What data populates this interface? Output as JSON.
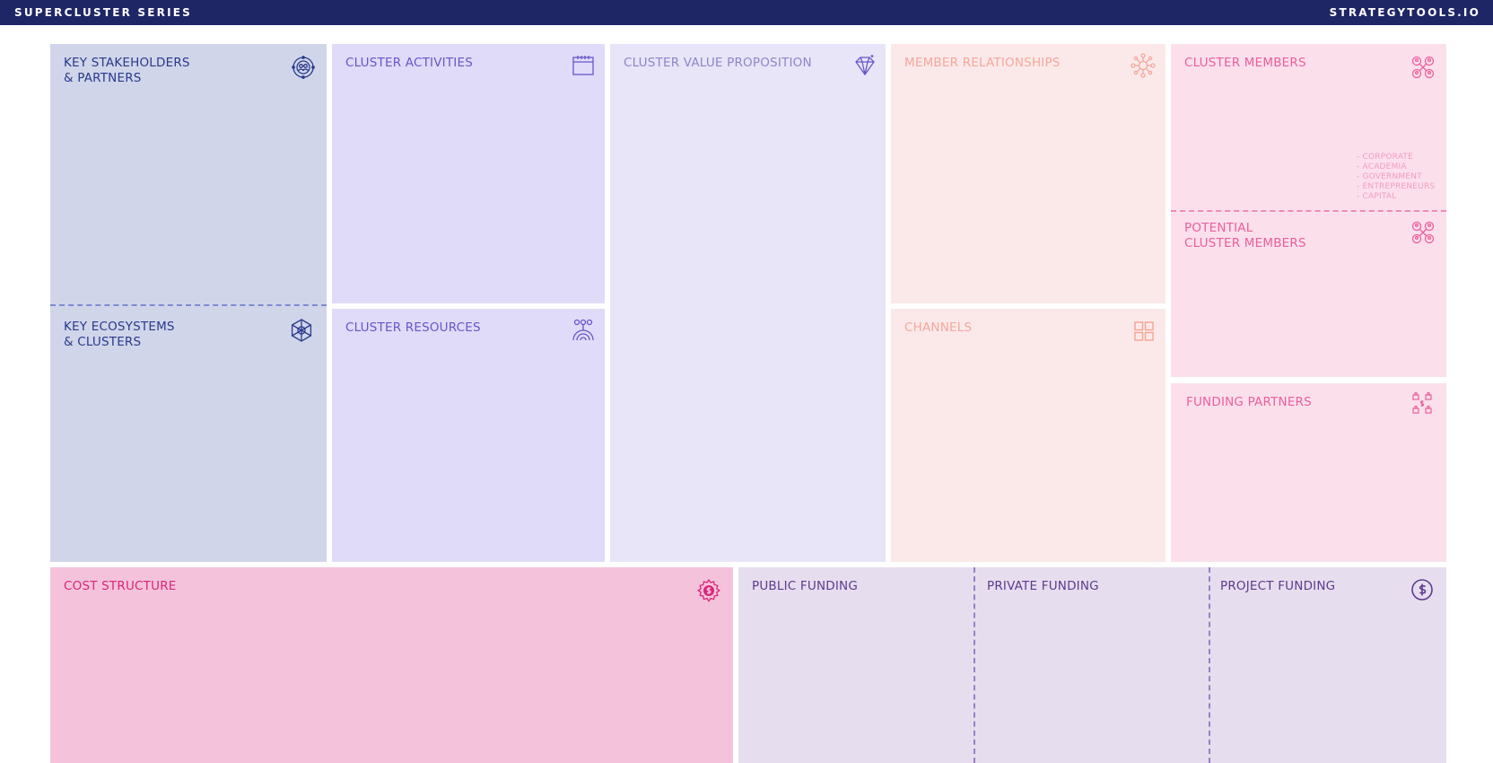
{
  "header": {
    "left_label": "SUPERCLUSTER SERIES",
    "right_label": "STRATEGYTOOLS.IO"
  },
  "colors": {
    "topbar": "#1f2666",
    "stakeholders_bg": "#d0d5ea",
    "stakeholders_text": "#2a3a8c",
    "activities_bg": "#e0dbf8",
    "activities_text": "#6a55c8",
    "value_bg": "#e8e5f8",
    "value_text": "#8d86c8",
    "relationships_bg": "#fbe9ea",
    "relationships_text": "#f4a89a",
    "members_bg": "#fbe0ec",
    "members_text": "#ec5f9c",
    "cost_bg": "#f5c2db",
    "cost_text": "#d8267a",
    "funding_bg": "#e6deee",
    "funding_text": "#5e3b8f"
  },
  "canvas": {
    "key_stakeholders": {
      "title": "KEY STAKEHOLDERS\n& PARTNERS",
      "icon": "people-network-icon"
    },
    "key_ecosystems": {
      "title": "KEY ECOSYSTEMS\n& CLUSTERS",
      "icon": "network-globe-icon"
    },
    "cluster_activities": {
      "title": "CLUSTER ACTIVITIES",
      "icon": "calendar-icon"
    },
    "cluster_resources": {
      "title": "CLUSTER RESOURCES",
      "icon": "resources-icon"
    },
    "cluster_value_proposition": {
      "title": "CLUSTER VALUE PROPOSITION",
      "icon": "diamond-icon"
    },
    "member_relationships": {
      "title": "MEMBER RELATIONSHIPS",
      "icon": "hub-network-icon"
    },
    "channels": {
      "title": "CHANNELS",
      "icon": "grid-icon"
    },
    "cluster_members": {
      "title": "CLUSTER MEMBERS",
      "icon": "members-cluster-icon",
      "types": [
        "- CORPORATE",
        "- ACADEMIA",
        "- GOVERNMENT",
        "- ENTREPRENEURS",
        "- CAPITAL"
      ]
    },
    "potential_cluster_members": {
      "title": "POTENTIAL\nCLUSTER MEMBERS",
      "icon": "members-cluster-icon"
    },
    "funding_partners": {
      "title": "FUNDING PARTNERS",
      "icon": "funding-network-icon"
    },
    "cost_structure": {
      "title": "COST STRUCTURE",
      "icon": "gear-dollar-icon"
    },
    "public_funding": {
      "title": "PUBLIC FUNDING"
    },
    "private_funding": {
      "title": "PRIVATE FUNDING"
    },
    "project_funding": {
      "title": "PROJECT FUNDING",
      "icon": "dollar-circle-icon"
    }
  }
}
